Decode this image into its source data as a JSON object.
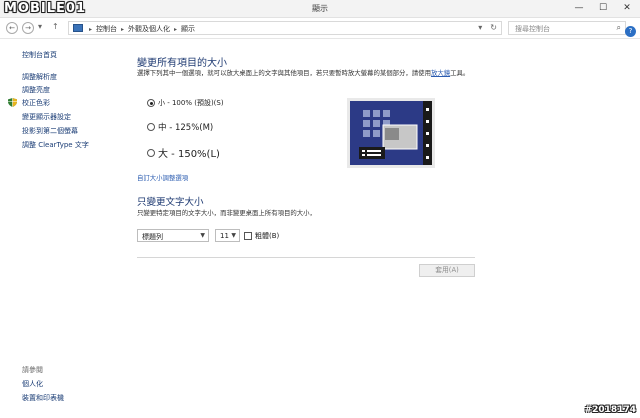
{
  "watermark": {
    "logo": "MOBILE01",
    "id": "#2018174"
  },
  "window": {
    "title": "顯示",
    "minimize": "—",
    "maximize": "☐",
    "close": "✕"
  },
  "nav": {
    "back": "←",
    "forward": "→",
    "dropdown": "▾",
    "up": "↑",
    "breadcrumbs": [
      "控制台",
      "外觀及個人化",
      "顯示"
    ],
    "address_dropdown": "▾",
    "refresh": "↻",
    "search_placeholder": "搜尋控制台",
    "help": "?"
  },
  "sidebar": {
    "home": "控制台首頁",
    "items": [
      "調整解析度",
      "調整亮度",
      "校正色彩",
      "變更顯示器設定",
      "投影到第二個螢幕",
      "調整 ClearType 文字"
    ],
    "see_also_heading": "請參閱",
    "see_also": [
      "個人化",
      "裝置和印表機"
    ]
  },
  "main": {
    "heading": "變更所有項目的大小",
    "description": "選擇下列其中一個選項，就可以放大桌面上的文字與其他項目，若只要暫時放大螢幕的某個部分，請使用",
    "description_link": "放大鏡",
    "description_suffix": "工具。",
    "options": [
      {
        "label": "小 - 100% (預設)(S)",
        "selected": true
      },
      {
        "label": "中 - 125%(M)",
        "selected": false
      },
      {
        "label": "大 - 150%(L)",
        "selected": false
      }
    ],
    "custom_link": "自訂大小調整選項",
    "text_heading": "只變更文字大小",
    "text_description": "只變更特定項目的文字大小，而非變更桌面上所有項目的大小，",
    "item_select": "標題列",
    "size_select": "11",
    "bold_label": "粗體(B)",
    "apply": "套用(A)"
  },
  "colors": {
    "heading": "#1e3a72",
    "link": "#2b5cb0",
    "preview_bg": "#2c3a86"
  }
}
